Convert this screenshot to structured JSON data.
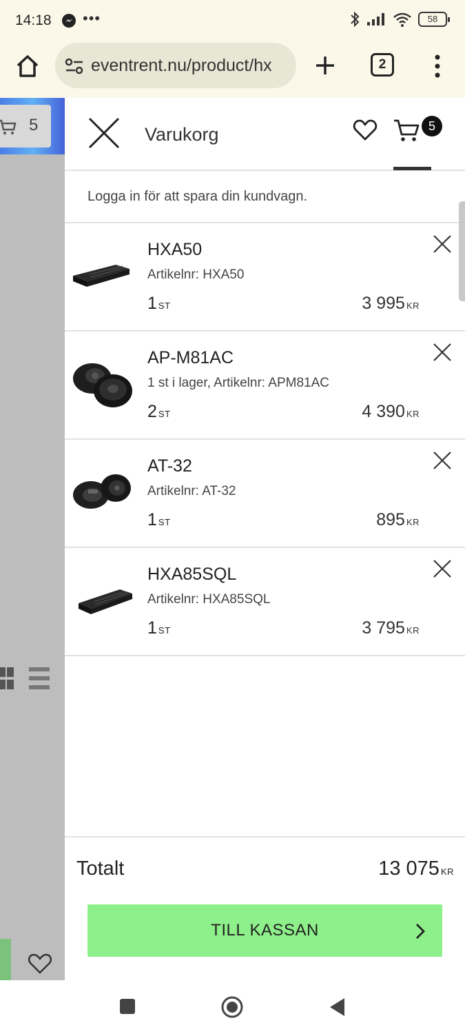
{
  "status_bar": {
    "time": "14:18",
    "dots": "•••",
    "battery": "58"
  },
  "browser": {
    "url": "eventrent.nu/product/hx",
    "tab_count": "2"
  },
  "background_page": {
    "cart_count": "5"
  },
  "cart": {
    "title": "Varukorg",
    "badge_count": "5",
    "login_note": "Logga in för att spara din kundvagn.",
    "items": [
      {
        "name": "HXA50",
        "sub": "Artikelnr: HXA50",
        "qty": "1",
        "qty_unit": "ST",
        "price": "3 995",
        "price_unit": "KR",
        "icon": "amplifier-image"
      },
      {
        "name": "AP-M81AC",
        "sub": "1 st i lager, Artikelnr: APM81AC",
        "qty": "2",
        "qty_unit": "ST",
        "price": "4 390",
        "price_unit": "KR",
        "icon": "speakers-image"
      },
      {
        "name": "AT-32",
        "sub": "Artikelnr: AT-32",
        "qty": "1",
        "qty_unit": "ST",
        "price": "895",
        "price_unit": "KR",
        "icon": "tweeters-image"
      },
      {
        "name": "HXA85SQL",
        "sub": "Artikelnr: HXA85SQL",
        "qty": "1",
        "qty_unit": "ST",
        "price": "3 795",
        "price_unit": "KR",
        "icon": "amplifier-image"
      }
    ],
    "total_label": "Totalt",
    "total_value": "13 075",
    "total_unit": "KR",
    "checkout_label": "TILL KASSAN",
    "checkout_color": "#8ef08a"
  }
}
